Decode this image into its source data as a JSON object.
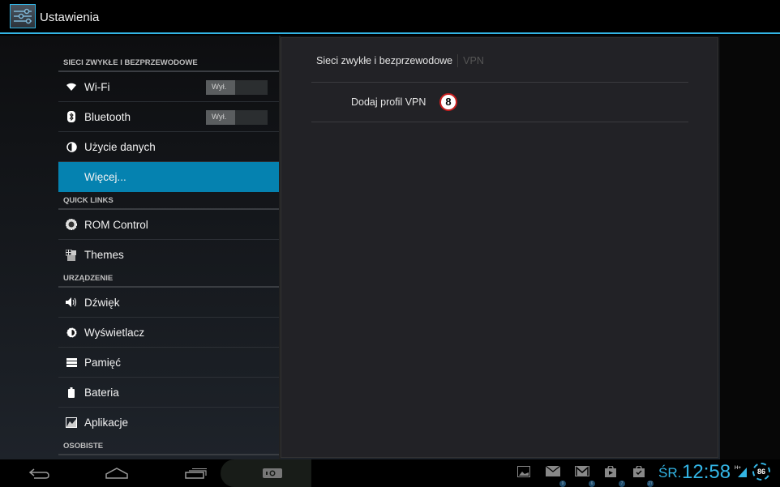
{
  "app": {
    "title": "Ustawienia",
    "icon": "settings-sliders-icon"
  },
  "colors": {
    "accent": "#33b5e5",
    "selected": "#0582b0",
    "badge_border": "#c81e1e"
  },
  "sidebar": {
    "sections": [
      {
        "header": "SIECI ZWYKŁE I BEZPRZEWODOWE",
        "items": [
          {
            "label": "Wi-Fi",
            "icon": "wifi-icon",
            "toggle": "Wył."
          },
          {
            "label": "Bluetooth",
            "icon": "bluetooth-icon",
            "toggle": "Wył."
          },
          {
            "label": "Użycie danych",
            "icon": "data-usage-icon"
          },
          {
            "label": "Więcej...",
            "selected": true
          }
        ]
      },
      {
        "header": "QUICK LINKS",
        "items": [
          {
            "label": "ROM Control",
            "icon": "rom-control-icon"
          },
          {
            "label": "Themes",
            "icon": "themes-icon"
          }
        ]
      },
      {
        "header": "URZĄDZENIE",
        "items": [
          {
            "label": "Dźwięk",
            "icon": "sound-icon"
          },
          {
            "label": "Wyświetlacz",
            "icon": "display-icon"
          },
          {
            "label": "Pamięć",
            "icon": "storage-icon"
          },
          {
            "label": "Bateria",
            "icon": "battery-icon"
          },
          {
            "label": "Aplikacje",
            "icon": "apps-icon"
          }
        ]
      },
      {
        "header": "OSOBISTE",
        "items": []
      }
    ]
  },
  "detail": {
    "breadcrumb_main": "Sieci zwykłe i bezprzewodowe",
    "breadcrumb_sub": "VPN",
    "items": [
      {
        "label": "Dodaj profil VPN"
      }
    ],
    "annotation_badge": "8"
  },
  "navbar": {
    "back": "back-icon",
    "home": "home-icon",
    "recents": "recent-apps-icon",
    "screenshot": "screenshot-icon"
  },
  "status": {
    "notifications": [
      {
        "icon": "gallery-icon",
        "count": ""
      },
      {
        "icon": "email-icon",
        "count": "9"
      },
      {
        "icon": "gmail-icon",
        "count": "6"
      },
      {
        "icon": "play-store-icon",
        "count": "7"
      },
      {
        "icon": "store-update-icon",
        "count": "27"
      }
    ],
    "day": "ŚR.",
    "time": "12:58",
    "network": "H+",
    "battery": "86"
  }
}
